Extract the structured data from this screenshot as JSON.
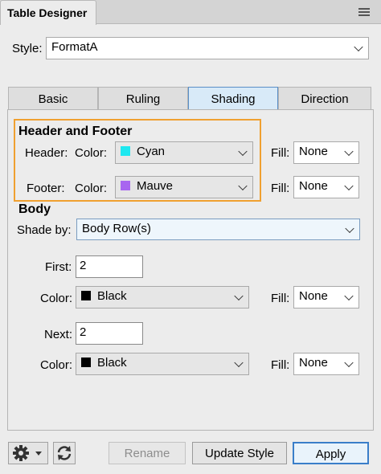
{
  "panel_title": "Table Designer",
  "style": {
    "label": "Style:",
    "value": "FormatA"
  },
  "tabs": [
    {
      "label": "Basic",
      "active": false
    },
    {
      "label": "Ruling",
      "active": false
    },
    {
      "label": "Shading",
      "active": true
    },
    {
      "label": "Direction",
      "active": false
    }
  ],
  "header_footer": {
    "title": "Header and Footer",
    "header_label": "Header:",
    "header_color_label": "Color:",
    "header_color": "Cyan",
    "header_swatch": "#1ee8f0",
    "header_fill_label": "Fill:",
    "header_fill": "None",
    "footer_label": "Footer:",
    "footer_color_label": "Color:",
    "footer_color": "Mauve",
    "footer_swatch": "#a866f0",
    "footer_fill_label": "Fill:",
    "footer_fill": "None"
  },
  "body": {
    "title": "Body",
    "shade_by_label": "Shade by:",
    "shade_by": "Body Row(s)",
    "first_label": "First:",
    "first_value": "2",
    "first_color_label": "Color:",
    "first_color": "Black",
    "first_swatch": "#000000",
    "first_fill_label": "Fill:",
    "first_fill": "None",
    "next_label": "Next:",
    "next_value": "2",
    "next_color_label": "Color:",
    "next_color": "Black",
    "next_swatch": "#000000",
    "next_fill_label": "Fill:",
    "next_fill": "None"
  },
  "footer_buttons": {
    "rename": "Rename",
    "update_style": "Update Style",
    "apply": "Apply"
  },
  "colors": {
    "accent": "#3a7ec9",
    "highlight_box": "#f0a030"
  }
}
